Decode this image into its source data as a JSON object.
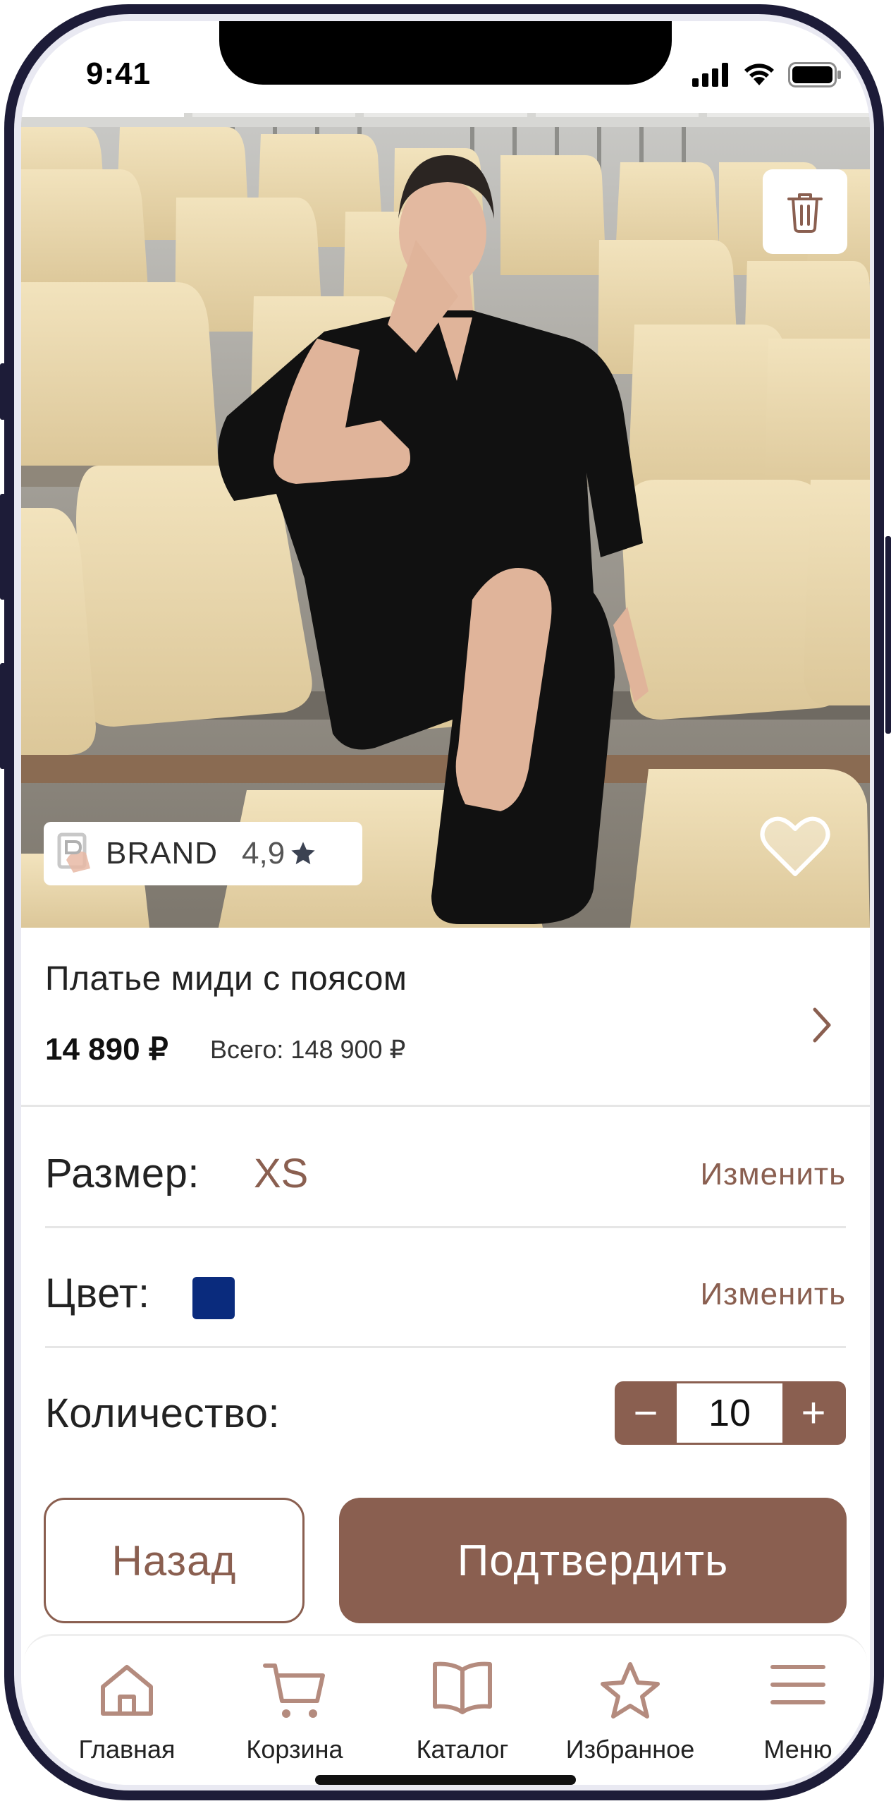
{
  "status_bar": {
    "time": "9:41"
  },
  "product": {
    "brand": "BRAND",
    "rating": "4,9",
    "title": "Платье миди с поясом",
    "price": "14 890 ₽",
    "total": "Всего: 148 900 ₽"
  },
  "options": {
    "size_label": "Размер:",
    "size_value": "XS",
    "color_label": "Цвет:",
    "color_value_hex": "#0a2b7d",
    "change_label": "Изменить",
    "quantity_label": "Количество:",
    "quantity_value": "10",
    "minus": "−",
    "plus": "+"
  },
  "actions": {
    "back": "Назад",
    "confirm": "Подтвердить"
  },
  "tabbar": {
    "items": [
      {
        "label": "Главная",
        "icon": "home-icon"
      },
      {
        "label": "Корзина",
        "icon": "cart-icon"
      },
      {
        "label": "Каталог",
        "icon": "book-icon"
      },
      {
        "label": "Избранное",
        "icon": "star-icon"
      },
      {
        "label": "Меню",
        "icon": "menu-icon"
      }
    ]
  },
  "colors": {
    "accent": "#8a5f50",
    "frame": "#1d1c38"
  },
  "carousel": {
    "slides": 5,
    "active": 1
  }
}
